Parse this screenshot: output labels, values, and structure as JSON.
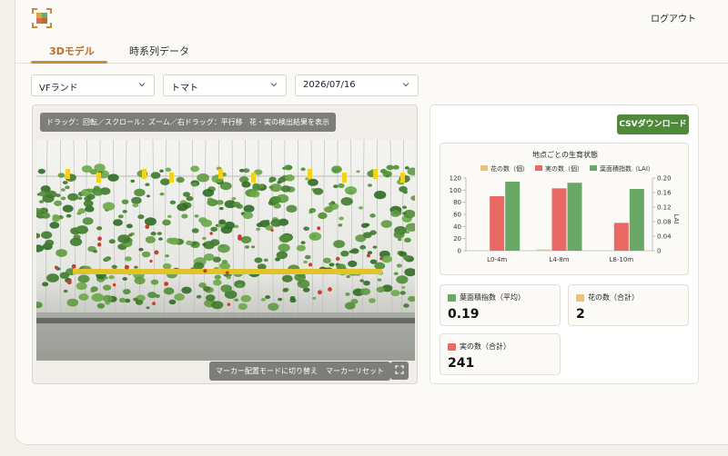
{
  "header": {
    "logout_label": "ログアウト"
  },
  "tabs": [
    {
      "label": "3Dモデル",
      "active": true
    },
    {
      "label": "時系列データ",
      "active": false
    }
  ],
  "filters": {
    "farm": "VFランド",
    "crop": "トマト",
    "date": "2026/07/16"
  },
  "viewer": {
    "hint": "ドラッグ：回転／スクロール：ズーム／右ドラッグ：平行移動",
    "detect_button": "花・実の検出結果を表示",
    "marker_mode_button": "マーカー配置モードに切り替え",
    "marker_reset_button": "マーカーリセット"
  },
  "panel": {
    "csv_button": "CSVダウンロード"
  },
  "colors": {
    "flowers": "#e8c27a",
    "fruits": "#e96a64",
    "lai": "#6aa868",
    "accent": "#4e8a3a",
    "tab_active": "#c06a2a"
  },
  "chart_data": {
    "type": "bar",
    "title": "地点ごとの生育状態",
    "categories": [
      "L0-4m",
      "L4-8m",
      "L8-10m"
    ],
    "series": [
      {
        "name": "花の数（個）",
        "values": [
          0,
          2,
          0
        ],
        "axis": "left"
      },
      {
        "name": "実の数（個）",
        "values": [
          90,
          103,
          46
        ],
        "axis": "left"
      },
      {
        "name": "葉面積指数（LAI）",
        "values": [
          0.19,
          0.187,
          0.17
        ],
        "axis": "right"
      }
    ],
    "ylim_left": [
      0,
      120
    ],
    "yticks_left": [
      "0",
      "20",
      "40",
      "60",
      "80",
      "100",
      "120"
    ],
    "ylim_right": [
      0,
      0.2
    ],
    "yticks_right": [
      "0",
      "0.04",
      "0.08",
      "0.12",
      "0.16",
      "0.20"
    ],
    "ylabel_right": "LAI",
    "legend": "top"
  },
  "stats": [
    {
      "label": "葉面積指数（平均）",
      "value": "0.19",
      "color": "#6aa868"
    },
    {
      "label": "花の数（合計）",
      "value": "2",
      "color": "#e8c27a"
    },
    {
      "label": "実の数（合計）",
      "value": "241",
      "color": "#e96a64"
    }
  ]
}
